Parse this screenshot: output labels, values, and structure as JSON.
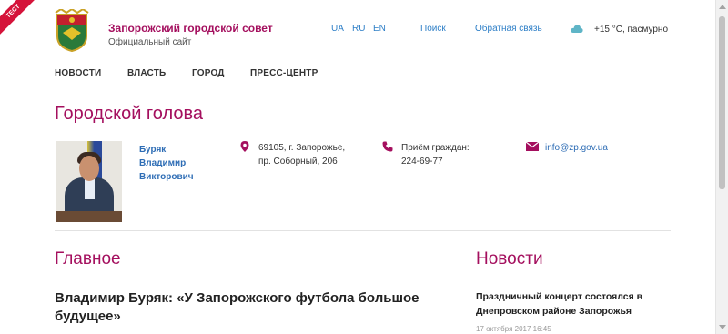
{
  "ribbon": {
    "label": "ТЕСТ"
  },
  "header": {
    "title": "Запорожский городской совет",
    "subtitle": "Официальный сайт",
    "languages": [
      "UA",
      "RU",
      "EN"
    ],
    "search_label": "Поиск",
    "feedback_label": "Обратная связь",
    "weather": {
      "icon": "cloud-icon",
      "text": "+15 °C, пасмурно"
    }
  },
  "nav": {
    "items": [
      "НОВОСТИ",
      "ВЛАСТЬ",
      "ГОРОД",
      "ПРЕСС-ЦЕНТР"
    ]
  },
  "mayor": {
    "section_title": "Городской голова",
    "name_line1": "Буряк",
    "name_line2": "Владимир",
    "name_line3": "Викторович",
    "address_line1": "69105, г. Запорожье,",
    "address_line2": "пр. Соборный, 206",
    "reception_label": "Приём граждан:",
    "reception_phone": "224-69-77",
    "email": "info@zp.gov.ua"
  },
  "main": {
    "section_title": "Главное",
    "lead_title": "Владимир Буряк: «У Запорожского футбола большое будущее»"
  },
  "news": {
    "section_title": "Новости",
    "first_title": "Праздничный концерт состоялся в Днепровском районе Запорожья",
    "first_date": "17 октября 2017 16:45"
  },
  "colors": {
    "brand": "#a40f5e",
    "link": "#2e7fc7",
    "accent_icon": "#a40f5e"
  }
}
